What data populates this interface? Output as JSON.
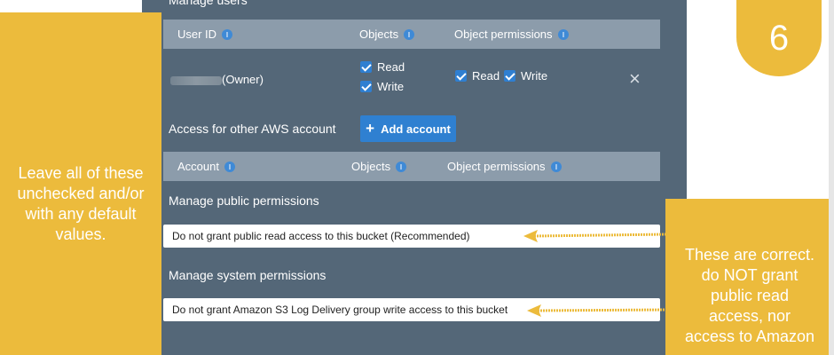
{
  "manage_users": {
    "title": "Manage users",
    "headers": {
      "user_id": "User ID",
      "objects": "Objects",
      "object_permissions": "Object permissions"
    },
    "owner": {
      "label": "(Owner)",
      "objects": [
        {
          "label": "Read",
          "checked": true
        },
        {
          "label": "Write",
          "checked": true
        }
      ],
      "object_permissions": [
        {
          "label": "Read",
          "checked": true
        },
        {
          "label": "Write",
          "checked": true
        }
      ]
    }
  },
  "other_accounts": {
    "label": "Access for other AWS account",
    "add_button": "Add account",
    "headers": {
      "account": "Account",
      "objects": "Objects",
      "object_permissions": "Object permissions"
    }
  },
  "public_permissions": {
    "title": "Manage public permissions",
    "value": "Do not grant public read access to this bucket (Recommended)"
  },
  "system_permissions": {
    "title": "Manage system permissions",
    "value": "Do not grant Amazon S3 Log Delivery group write access to this bucket"
  },
  "annotations": {
    "left_note": [
      "Leave all of these",
      "unchecked and/or",
      "with any default",
      "values."
    ],
    "right_note": [
      "These are correct.",
      "do NOT grant",
      "public read",
      "access, nor",
      "access to Amazon"
    ],
    "step": "6"
  },
  "colors": {
    "accent": "#ecbb3c",
    "panel": "#546778",
    "primary_button": "#2f80d1"
  }
}
